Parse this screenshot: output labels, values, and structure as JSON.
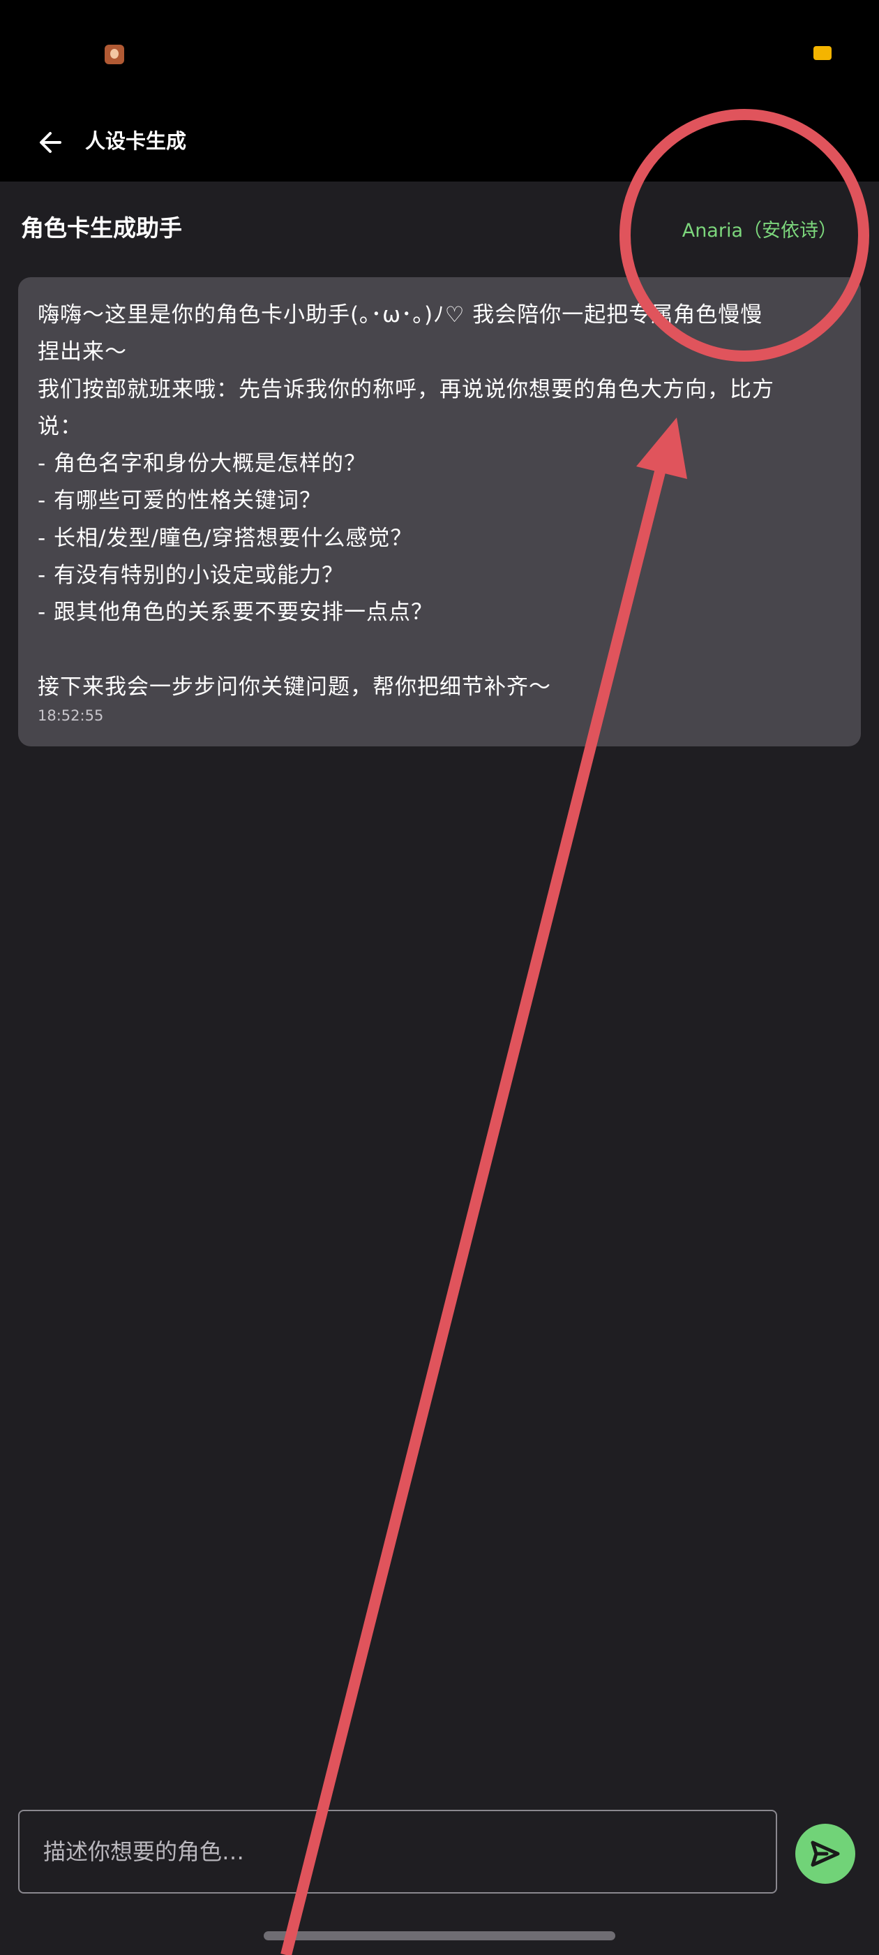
{
  "app_bar": {
    "title": "人设卡生成"
  },
  "header": {
    "assistant_title": "角色卡生成助手",
    "persona_name": "Anaria（安依诗）"
  },
  "message": {
    "text": "嗨嗨～这里是你的角色卡小助手(｡･ω･｡)ﾉ♡ 我会陪你一起把专属角色慢慢\n捏出来～\n我们按部就班来哦：先告诉我你的称呼，再说说你想要的角色大方向，比方\n说：\n- 角色名字和身份大概是怎样的？\n- 有哪些可爱的性格关键词？\n- 长相/发型/瞳色/穿搭想要什么感觉？\n- 有没有特别的小设定或能力？\n- 跟其他角色的关系要不要安排一点点？\n\n接下来我会一步步问你关键问题，帮你把细节补齐～",
    "time": "18:52:55"
  },
  "composer": {
    "placeholder": "描述你想要的角色…"
  },
  "icons": {
    "back": "arrow-left-icon",
    "send": "send-icon",
    "status_app": "app-avatar-icon",
    "battery": "battery-icon"
  },
  "colors": {
    "accent_green": "#71d378",
    "persona_green": "#7cd67c",
    "bubble": "#48464c",
    "annotation_red": "#e0545c"
  }
}
